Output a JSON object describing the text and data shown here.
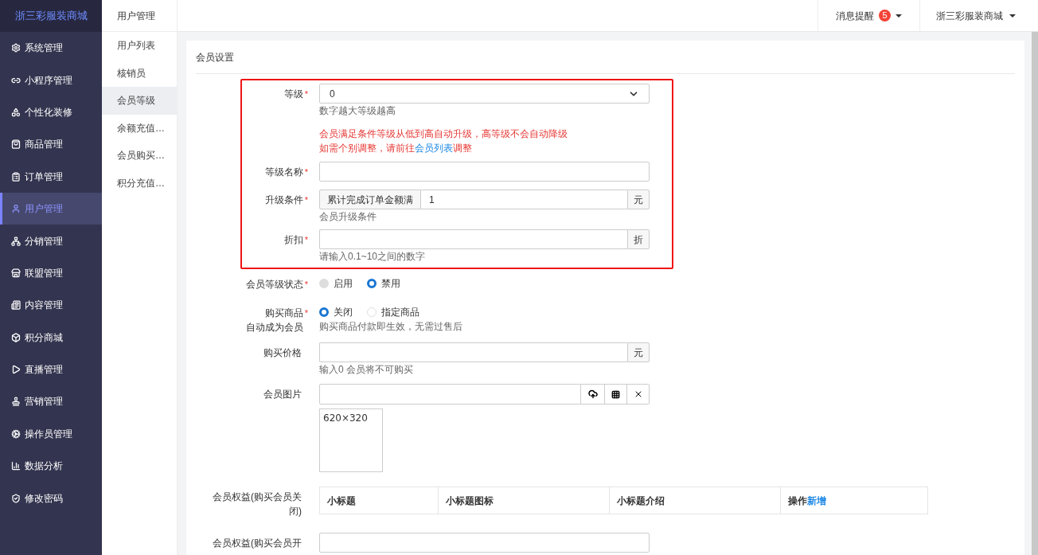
{
  "brand": "浙三彩服装商城",
  "sidebar": {
    "items": [
      {
        "label": "系统管理",
        "selected": false
      },
      {
        "label": "小程序管理",
        "selected": false
      },
      {
        "label": "个性化装修",
        "selected": false
      },
      {
        "label": "商品管理",
        "selected": false
      },
      {
        "label": "订单管理",
        "selected": false
      },
      {
        "label": "用户管理",
        "selected": true
      },
      {
        "label": "分销管理",
        "selected": false
      },
      {
        "label": "联盟管理",
        "selected": false
      },
      {
        "label": "内容管理",
        "selected": false
      },
      {
        "label": "积分商城",
        "selected": false
      },
      {
        "label": "直播管理",
        "selected": false
      },
      {
        "label": "营销管理",
        "selected": false
      },
      {
        "label": "操作员管理",
        "selected": false
      },
      {
        "label": "数据分析",
        "selected": false
      },
      {
        "label": "修改密码",
        "selected": false
      }
    ]
  },
  "submenu": {
    "title": "用户管理",
    "items": [
      {
        "label": "用户列表",
        "selected": false
      },
      {
        "label": "核销员",
        "selected": false
      },
      {
        "label": "会员等级",
        "selected": true
      },
      {
        "label": "余额充值…",
        "selected": false
      },
      {
        "label": "会员购买…",
        "selected": false
      },
      {
        "label": "积分充值…",
        "selected": false
      }
    ]
  },
  "header": {
    "notifications": {
      "label": "消息提醒",
      "count": "5"
    },
    "account": "浙三彩服装商城"
  },
  "form": {
    "title": "会员设置",
    "highlighted_fields": [
      {
        "kind": "select",
        "label": "等级",
        "required_mark": "*",
        "value": "0",
        "hint": "数字越大等级越高",
        "notice": {
          "line1": "会员满足条件等级从低到高自动升级，高等级不会自动降级",
          "line2_before": "如需个别调整，请前往",
          "line2_link": "会员列表",
          "line2_after": "调整"
        }
      },
      {
        "kind": "text",
        "label": "等级名称",
        "required_mark": "*"
      },
      {
        "kind": "prefix_input",
        "label": "升级条件",
        "required_mark": "*",
        "prefix": "累计完成订单金额满",
        "value": "1",
        "suffix": "元",
        "hint": "会员升级条件"
      },
      {
        "kind": "suffix_input",
        "label": "折扣",
        "required_mark": "*",
        "suffix": "折",
        "hint": "请输入0.1~10之间的数字"
      }
    ],
    "fields": [
      {
        "kind": "radio",
        "label": [
          "会员等级状态"
        ],
        "required_mark": "*",
        "options": [
          {
            "label": "启用",
            "selected": false,
            "disabled": true
          },
          {
            "label": "禁用",
            "selected": true,
            "disabled": false
          }
        ]
      },
      {
        "kind": "radio",
        "label": [
          "购买商品",
          "自动成为会员"
        ],
        "required_mark": "*",
        "options": [
          {
            "label": "关闭",
            "selected": true,
            "disabled": false
          },
          {
            "label": "指定商品",
            "selected": false,
            "disabled": false
          }
        ],
        "hint": "购买商品付款即生效，无需过售后"
      },
      {
        "kind": "suffix_input",
        "label": [
          "购买价格"
        ],
        "suffix": "元",
        "hint": "输入0 会员将不可购买"
      },
      {
        "kind": "image",
        "label": [
          "会员图片"
        ],
        "preview": "620×320"
      },
      {
        "kind": "table",
        "label": [
          "会员权益(购买会员关",
          "闭)"
        ],
        "columns": [
          "小标题",
          "小标题图标",
          "小标题介绍",
          "操作"
        ],
        "action_link": "新增"
      },
      {
        "kind": "text",
        "label": [
          "会员权益(购买会员开"
        ]
      }
    ]
  }
}
